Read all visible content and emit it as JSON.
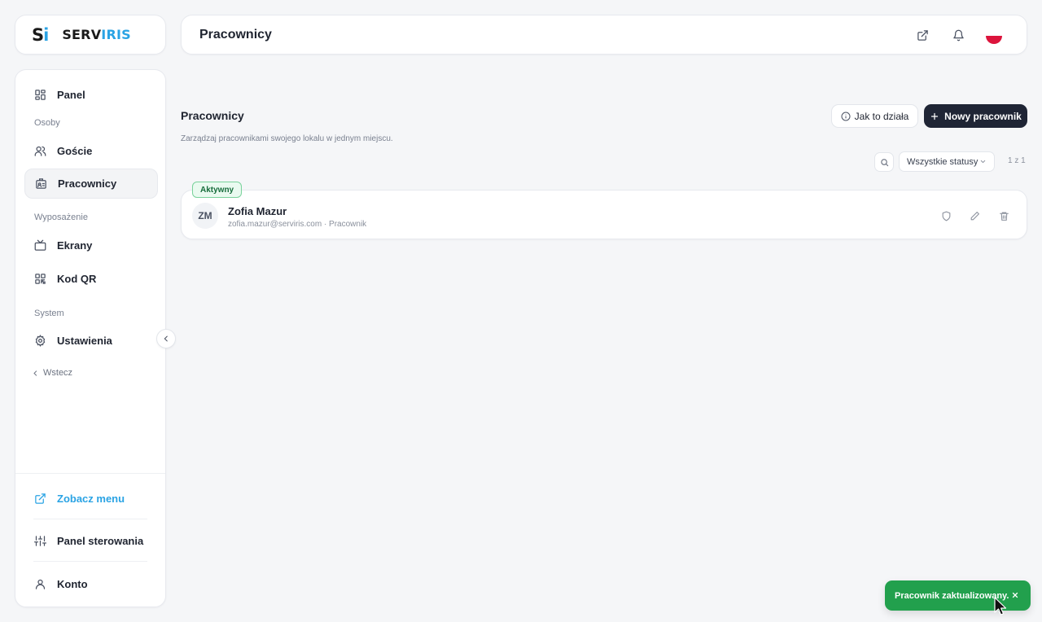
{
  "logo": {
    "mark_s": "S",
    "mark_i": "i",
    "brand_a": "SERV",
    "brand_b": "IRIS"
  },
  "sidebar": {
    "items": [
      {
        "label": "Panel"
      },
      {
        "label": "Goście"
      },
      {
        "label": "Pracownicy"
      },
      {
        "label": "Ekrany"
      },
      {
        "label": "Kod QR"
      },
      {
        "label": "Ustawienia"
      }
    ],
    "sections": {
      "people": "Osoby",
      "equipment": "Wyposażenie",
      "system": "System"
    },
    "back": "Wstecz",
    "footer": {
      "view_menu": "Zobacz menu",
      "control_panel": "Panel sterowania",
      "account": "Konto"
    }
  },
  "header": {
    "title": "Pracownicy"
  },
  "page": {
    "title": "Pracownicy",
    "subtitle": "Zarządzaj pracownikami swojego lokalu w jednym miejscu.",
    "help_button": "Jak to działa",
    "new_button": "Nowy pracownik",
    "status_filter": "Wszystkie statusy",
    "pagination": "1 z 1"
  },
  "employees": [
    {
      "status": "Aktywny",
      "initials": "ZM",
      "name": "Zofia Mazur",
      "meta": "zofia.mazur@serviris.com · Pracownik"
    }
  ],
  "toast": {
    "message": "Pracownik zaktualizowany."
  },
  "colors": {
    "accent": "#2aa3e4",
    "dark_button": "#1f2535",
    "toast": "#22a04d",
    "badge_border": "#79d29b"
  }
}
